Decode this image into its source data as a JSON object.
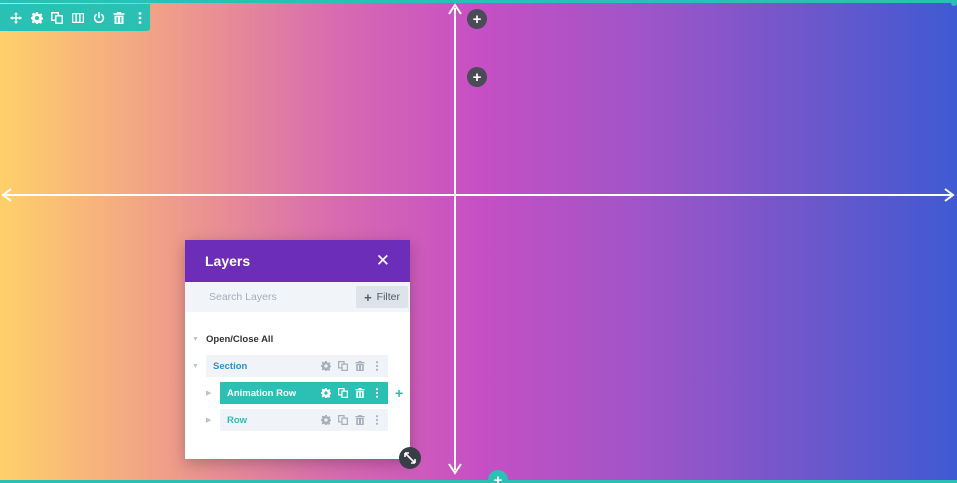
{
  "colors": {
    "accent": "#2bc0b4",
    "panel_header": "#6c2eb9",
    "dark_button": "#4a4b57"
  },
  "toolbar": {
    "icons": [
      "move-icon",
      "gear-icon",
      "duplicate-icon",
      "columns-icon",
      "power-icon",
      "trash-icon",
      "more-icon"
    ]
  },
  "canvas": {
    "add_buttons": [
      "+",
      "+",
      "+"
    ]
  },
  "layers": {
    "title": "Layers",
    "close": "✕",
    "search_placeholder": "Search Layers",
    "filter_label": "Filter",
    "filter_icon": "+",
    "open_close_all": "Open/Close All",
    "items": [
      {
        "label": "Section",
        "color": "#2e8ed6",
        "active": false
      },
      {
        "label": "Animation Row",
        "color": "#ffffff",
        "active": true
      },
      {
        "label": "Row",
        "color": "#2bc0b4",
        "active": false
      }
    ],
    "add_icon": "+"
  }
}
